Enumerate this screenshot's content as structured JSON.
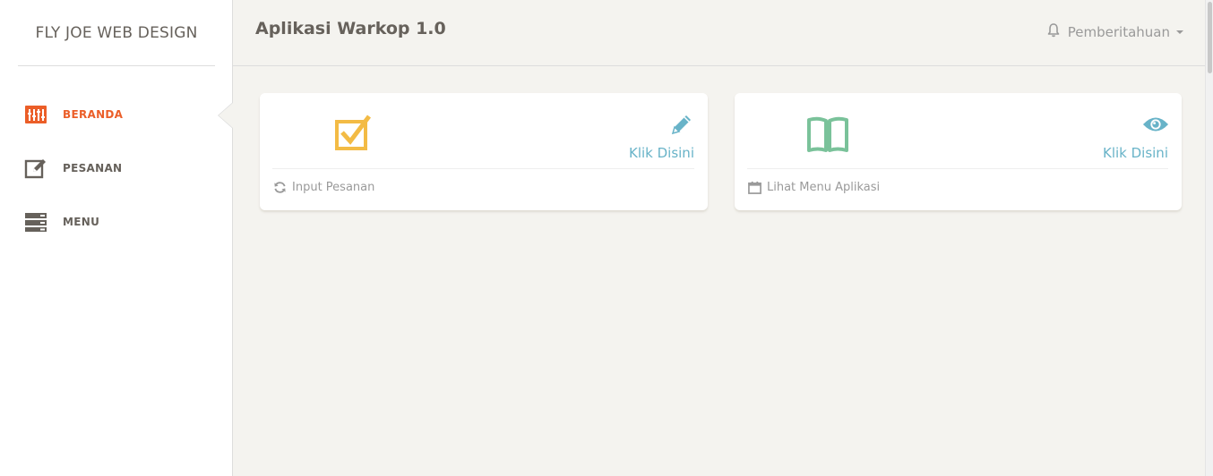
{
  "sidebar": {
    "brand": "FLY JOE WEB DESIGN",
    "items": [
      {
        "label": "BERANDA",
        "icon": "dashboard-icon",
        "active": true
      },
      {
        "label": "PESANAN",
        "icon": "edit-icon",
        "active": false
      },
      {
        "label": "MENU",
        "icon": "server-list-icon",
        "active": false
      }
    ]
  },
  "header": {
    "title": "Aplikasi Warkop 1.0",
    "notifications_label": "Pemberitahuan"
  },
  "cards": [
    {
      "icon": "checkbox-icon",
      "icon_color": "#f3bb45",
      "action_icon": "pencil-icon",
      "action_label": "Klik Disini",
      "footer_icon": "refresh-icon",
      "footer_label": "Input Pesanan"
    },
    {
      "icon": "open-book-icon",
      "icon_color": "#7ac29a",
      "action_icon": "eye-icon",
      "action_label": "Klik Disini",
      "footer_icon": "calendar-icon",
      "footer_label": "Lihat Menu Aplikasi"
    }
  ],
  "colors": {
    "accent_orange": "#eb5e28",
    "info_blue": "#68b3c8",
    "warning_yellow": "#f3bb45",
    "success_green": "#7ac29a",
    "background": "#f4f3ef"
  }
}
